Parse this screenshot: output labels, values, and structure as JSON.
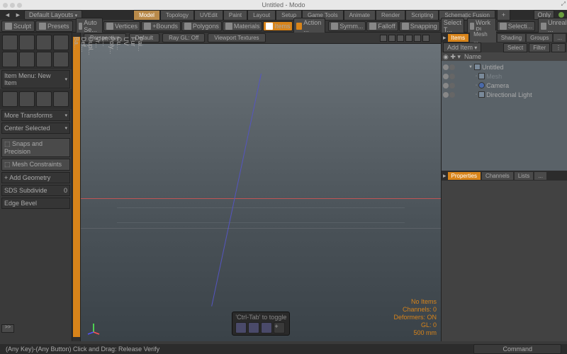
{
  "title": "Untitled - Modo",
  "layouts_label": "Default Layouts",
  "only_label": "Only",
  "menu_tabs": [
    "Model",
    "Topology",
    "UVEdit",
    "Paint",
    "Layout",
    "Setup",
    "Game Tools",
    "Animate",
    "Render",
    "Scripting",
    "Schematic Fusion"
  ],
  "active_menu_tab": "Model",
  "toolbar": {
    "sculpt": "Sculpt",
    "presets": "Presets",
    "autose": "Auto Se...",
    "vertices": "Vertices",
    "bounds": "+Bounds",
    "polygons": "Polygons",
    "materials": "Materials",
    "items": "Items",
    "action": "Action ...",
    "symm": "Symm...",
    "falloff": "Falloff",
    "snapping": "Snapping",
    "selectt": "Select T...",
    "workpl": "Work Pl...",
    "selecti": "Selecti...",
    "unreal": "Unreal ..."
  },
  "left_panel": {
    "item_menu": "Item Menu: New Item",
    "more_transforms": "More Transforms",
    "center_selected": "Center Selected",
    "snaps": "Snaps and Precision",
    "mesh_constraints": "Mesh Constraints",
    "add_geometry": "Add Geometry",
    "sds": "SDS Subdivide",
    "sds_val": "0",
    "edge_bevel": "Edge Bevel",
    "dd": ">>"
  },
  "vertical_tabs": [
    "Ba...",
    "Def...",
    "Dupl...",
    "Vr...",
    "E...",
    "Poly...",
    "Cu...",
    "UV",
    "Fur",
    "Pai..."
  ],
  "viewport_bar": {
    "perspective": "Perspective",
    "default": "Default",
    "raygl": "Ray GL: Off",
    "textures": "Viewport Textures"
  },
  "hint": {
    "label": "'Ctrl-Tab' to toggle"
  },
  "stats": {
    "noitems": "No Items",
    "channels": "Channels: 0",
    "deformers": "Deformers: ON",
    "gl": "GL: 0",
    "mm": "500 mm"
  },
  "right": {
    "tabs": [
      "Items",
      "Mesh ...",
      "Shading",
      "Groups",
      "..."
    ],
    "add_item": "Add Item",
    "select": "Select",
    "filter": "Filter",
    "name_col": "Name",
    "tree": [
      {
        "name": "Untitled",
        "indent": 1,
        "expand": true,
        "icon": "scene"
      },
      {
        "name": "Mesh",
        "indent": 2,
        "icon": "mesh",
        "dim": true
      },
      {
        "name": "Camera",
        "indent": 2,
        "icon": "cam"
      },
      {
        "name": "Directional Light",
        "indent": 2,
        "icon": "light"
      }
    ],
    "prop_tabs": [
      "Properties",
      "Channels",
      "Lists",
      "..."
    ]
  },
  "status": {
    "hint": "(Any Key)-(Any Button) Click and Drag:   Release Verify",
    "command": "Command"
  }
}
